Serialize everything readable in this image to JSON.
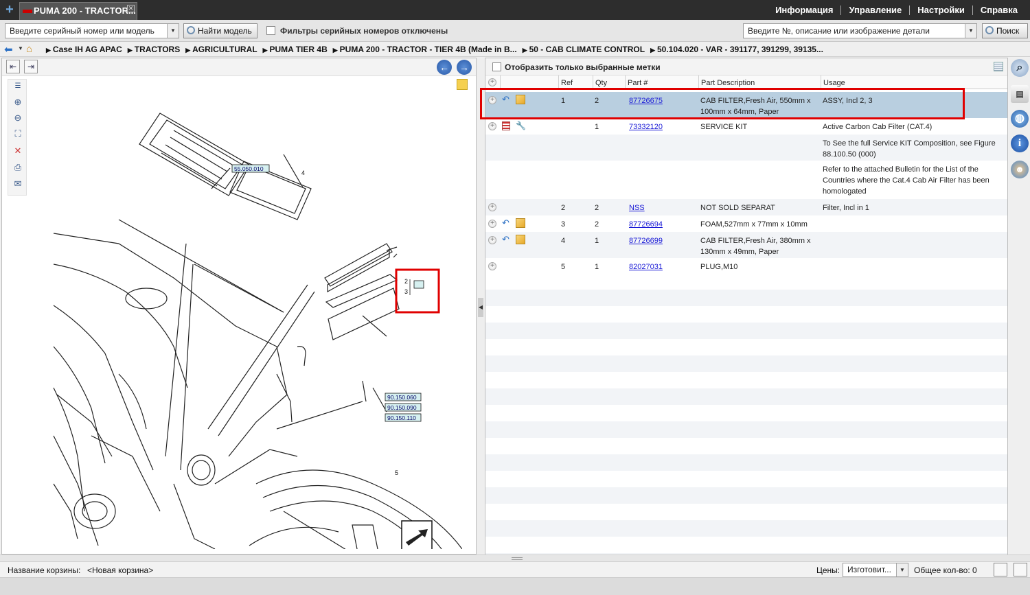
{
  "tab": {
    "title": "PUMA 200 - TRACTOR..."
  },
  "topmenu": [
    "Информация",
    "Управление",
    "Настройки",
    "Справка"
  ],
  "toolbar": {
    "serial_placeholder": "Введите серийный номер или модель",
    "find_model_label": "Найти модель",
    "filter_label": "Фильтры серийных номеров отключены",
    "search_placeholder": "Введите №, описание или изображение детали",
    "search_label": "Поиск"
  },
  "breadcrumbs": [
    "Case IH AG APAC",
    "TRACTORS",
    "AGRICULTURAL",
    "PUMA TIER 4B",
    "PUMA 200 - TRACTOR - TIER 4B (Made in B...",
    "50 - CAB CLIMATE CONTROL",
    "50.104.020 - VAR - 391177, 391299, 39135..."
  ],
  "diagram": {
    "callouts": [
      "55.050.010",
      "90.150.060",
      "90.150.090",
      "90.150.110"
    ],
    "ref_labels": [
      "4",
      "2",
      "3",
      "1",
      "5"
    ]
  },
  "parts": {
    "show_selected_label": "Отобразить только выбранные метки",
    "headers": {
      "ref": "Ref",
      "qty": "Qty",
      "part": "Part #",
      "desc": "Part Description",
      "usage": "Usage"
    },
    "rows": [
      {
        "ref": "1",
        "qty": "2",
        "part": "87726675",
        "desc1": "CAB FILTER,Fresh Air, 550mm x",
        "desc2": "100mm x 64mm, Paper",
        "usage": "ASSY, Incl 2, 3"
      },
      {
        "ref": "",
        "qty": "1",
        "part": "73332120",
        "desc1": "SERVICE KIT",
        "desc2": "",
        "usage": "Active Carbon Cab Filter (CAT.4)"
      },
      {
        "note1": "To See the full Service KIT Composition, see Figure",
        "note2": "88.100.50 (000)"
      },
      {
        "note1": "Refer to the attached Bulletin for the List of the",
        "note2": "Countries where the Cat.4 Cab Air Filter has been",
        "note3": "homologated"
      },
      {
        "ref": "2",
        "qty": "2",
        "part": "NSS",
        "desc1": "NOT SOLD SEPARAT",
        "usage": "Filter, Incl in 1"
      },
      {
        "ref": "3",
        "qty": "2",
        "part": "87726694",
        "desc1": "FOAM,527mm x 77mm x 10mm",
        "usage": ""
      },
      {
        "ref": "4",
        "qty": "1",
        "part": "87726699",
        "desc1": "CAB FILTER,Fresh Air, 380mm x",
        "desc2": "130mm x 49mm, Paper",
        "usage": ""
      },
      {
        "ref": "5",
        "qty": "1",
        "part": "82027031",
        "desc1": "PLUG,M10",
        "usage": ""
      }
    ]
  },
  "status": {
    "cart_label": "Название корзины:",
    "cart_name": "<Новая корзина>",
    "prices_label": "Цены:",
    "prices_value": "Изготовит...",
    "total_label": "Общее кол-во: 0"
  },
  "colors": {
    "selection": "#b9cfe0",
    "highlight": "#e00000",
    "link": "#1a1ad6",
    "topbar": "#2d2d2d"
  }
}
